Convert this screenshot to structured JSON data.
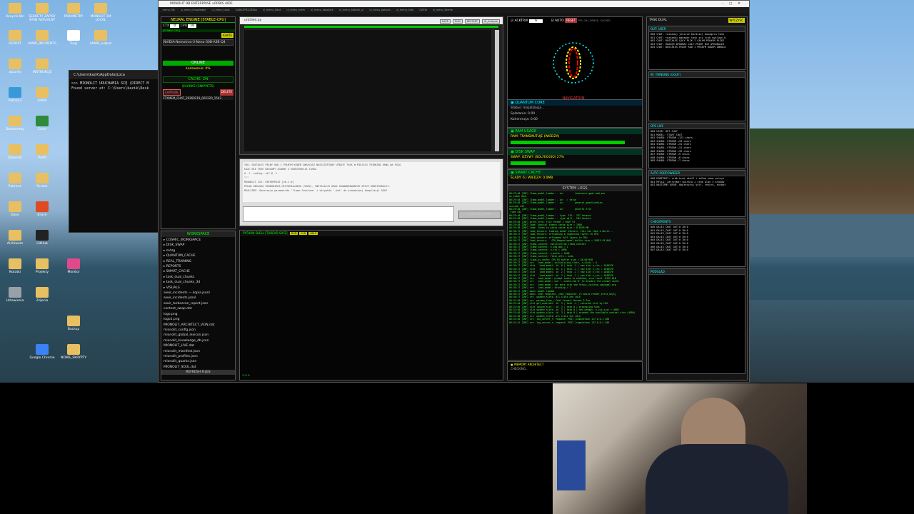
{
  "desktop": {
    "icons": [
      {
        "label": "Recycle Bin",
        "color": "#e8c062"
      },
      {
        "label": "SEKRETY ZAPISY STAN AKTUALNY",
        "color": "#e8c062"
      },
      {
        "label": "PARAMETRY",
        "color": "#e8c062"
      },
      {
        "label": "MONOLIT 1M LOCAL",
        "color": "#e8c062"
      },
      {
        "label": "REPORT",
        "color": "#e8c062"
      },
      {
        "label": "AIWIR_INCIDENTS",
        "color": "#e8c062"
      },
      {
        "label": "Tlogi",
        "color": "#ffffff"
      },
      {
        "label": "AIWIR_output",
        "color": "#e8c062"
      },
      {
        "label": "aipurity",
        "color": "#e8c062"
      },
      {
        "label": "INSTRUKCJE",
        "color": "#e8c062"
      },
      {
        "label": "Python3",
        "color": "#3a9ad9"
      },
      {
        "label": "AIWIR",
        "color": "#e8c062"
      },
      {
        "label": "Dokumenty",
        "color": "#e8c062"
      },
      {
        "label": "Excel",
        "color": "#2e8b3a"
      },
      {
        "label": "Dziennik",
        "color": "#e8c062"
      },
      {
        "label": "Profil",
        "color": "#e8c062"
      },
      {
        "label": "Pobrane",
        "color": "#e8c062"
      },
      {
        "label": "Serwer",
        "color": "#e8c062"
      },
      {
        "label": "Dane",
        "color": "#e8c062"
      },
      {
        "label": "Brave",
        "color": "#e04a22"
      },
      {
        "label": "Archiwum",
        "color": "#e8c062"
      },
      {
        "label": "GitHub",
        "color": "#222222"
      },
      {
        "label": "Notatki",
        "color": "#e8c062"
      },
      {
        "label": "Projekty",
        "color": "#e8c062"
      },
      {
        "label": "Monitor",
        "color": "#e04a8a"
      },
      {
        "label": "Ustawienia",
        "color": "#9aa0a8"
      },
      {
        "label": "Zdjecia",
        "color": "#e8c062"
      },
      {
        "label": "Google Chrome",
        "color": "#3b82f6"
      },
      {
        "label": "Backup",
        "color": "#e8c062"
      },
      {
        "label": "NOWE_SKRYPTY",
        "color": "#e8c062"
      }
    ]
  },
  "cmd": {
    "title": "C:\\Users\\kazik\\AppData\\Loca",
    "lines": ">>> MIONOLIT URUCHAMIA SIĘ (DIRECT M\nFound server at: C:\\Users\\kazik\\Desk"
  },
  "app": {
    "title": "MONOLIT 9B ENTERPRISE vORBIS AIDE",
    "menu": [
      "_menu_file",
      "ui_menu_knowledge",
      "ui_menu_tools",
      "ZABEZPIECZENIA",
      "ui_menu_kitna",
      "ui_menu_mem",
      "ui_menu_obsolute",
      "ui_menu_adenial_ui",
      "ui_menu_options",
      "ui_menu_help",
      "OZEW",
      "ui_menu_theme"
    ],
    "engine": {
      "header": "NEURAL ENGINE [STABLE-CPU]",
      "ctx_label": "CTX",
      "ctx_value": "0",
      "cpu_label": "CPU",
      "cpu_value": "16",
      "stable": "[STABLE CPU]",
      "ignite": "IGNITE",
      "model": "NVIDIA-Nemotron-3-Nano-30B-A3B-Q4",
      "online": "ONLINE",
      "loading": "Ładowanie: 0%",
      "cache": "CACHE: ON",
      "quarks": "QUARKS (SNIPPETS)",
      "capture": "CAPTURE",
      "delete": "DELETE",
      "snippet": "CTXMEM_CHAT_20260219_002220_1543"
    },
    "workspace": {
      "header": "WORKSPACE",
      "items": [
        "COSMIC_WORKSPACE",
        "DISK_SWAP",
        "mózg",
        "QUANTUM_CACHE",
        "REAL_TRAINING",
        "REPORTS",
        "SMART_CACHE",
        "task_dual_chunks",
        "task_dual_chunks_3d",
        "VISUALS",
        "aiwir_incidents — kopia.jsonl",
        "aiwir_incidents.jsonl",
        "aiwir_turboscan_report.json",
        "context_swap.dat",
        "logo.png",
        "logo1.png",
        "MIONOLIT_ARCHITECT_VEIN.dat",
        "mionolit_config.json",
        "mionolit_global_lexicon.json",
        "mionolit_knowledge_db.json",
        "MIONOLIT_LIVE.dat",
        "mionolit_manifest.json",
        "mionolit_profiles.json",
        "mionolit_quarks.json",
        "MIONOLIT_SOUL.dat"
      ],
      "refresh": "REFRESH FILES"
    },
    "editor": {
      "tab": "untitled.py",
      "btns": [
        "SAVE",
        "RUN",
        "RESTART",
        "AI_Analyze"
      ]
    },
    "chat": {
      "text": "YOU: DOSTAŁEŚ PEŁNY KOD I PEŁNYM KODEM ZWRACASZ NASZCZEPIONY UPDATE TASK W MIEJSCU THINKING OKNA NA POJA\nKIAC NIE TRZE BEZŁOMY ZGODNY Z KONSTRUKCJA TASKA\n# -*- coding: utf-8 -*-\n\"\"\"\nMIONOLIT ISI: ENTERPRISE [v0.1.0]\nPEŁNA OBSŁUGA ŚRODOWISKA HISTORIALNEGO (VENV), INSTALACJI ORAZ ZAAWANSOWANYCH OPCJI KONFIGURACJI.\nREALIZMY: Generacja parametrów 'llama-finetune' i skryptów '.bat' do prawdziwej kompilacji GGUF.",
      "send": "SEND",
      "dalej": "DALEJ"
    },
    "shell": {
      "header": "PYTHON SHELL [THREAD SAFE]",
      "prompt": ">>>",
      "btns": [
        "RUN",
        "CLR",
        "HELP"
      ]
    },
    "radar": {
      "actrix": "ACKTRIX",
      "auto": "AUTO",
      "reset": "RESET",
      "stats": "FPS: 28 | DENSE: CACHED",
      "caption": "NAVIGATION"
    },
    "quantum": {
      "header": "QUANTUM CORE",
      "status": "Status: Inicjalizacja...",
      "splatanie": "Splatanie: 0.00",
      "koherencja": "Koherencja: 0.00"
    },
    "ram": {
      "header": "RAM USAGE",
      "text": "RAM: TRANSMUTUJE (WIEDZA)",
      "fill": 0.88
    },
    "disk": {
      "header": "DISK SWAP",
      "text": "SWAP: OŻYWY (SOLFEGGIO) 27%",
      "fill": 0.27
    },
    "smart": {
      "header": "SMART CACHE",
      "text": "ŚLADY: 6 | WIEDZA: 0.0MB"
    },
    "syslog": {
      "header": "SYSTEM LOGS",
      "text": "00:29:48 [INF] llama_model_loader: - kv:        tokenizer.ggml.add_eos\nos_token bool\n00:29:48 [INF] llama_model_loader: - kv:  = false\n00:29:48 [INF] llama_model_loader: - kv:        general.quantization\nversion u32\n00:29:48 [INF] llama_model_loader: - kv:        general.file\n_type u32\n00:29:48 [INF] llama_model_loader: - type  f32:  337 tensors\n00:29:48 [INF] llama_model_loader: - type q4_K:  284 tensors\n00:29:48 [INF] print_info: file format = GGUF V3\n00:29:48 [INF] load: special tokens cache size = 1000\n00:29:48 [INF] load: token to piece cache size = 0.8459 MB\n00:30:17 [INF] load_tensors: loading model tensors, this can take a while...\n00:30:17 [INF] load_tensors: offloading 0 repeating layers to GPU\n00:30:17 [INF] load_tensors: offloaded 0/53 layers to GPU\n00:30:17 [INF] load_tensors:   CPU_Mapped model buffer size = 16813.49 MiB\n00:30:17 [INF] llama_context: constructing llama_context\n00:30:17 [INF] llama_context: n_seq_max = 1\n00:30:17 [INF] llama_context: n_ctx = 4096\n00:30:17 [INF] llama_context: n_batch = 2048\n00:30:17 [INF] llama_context: flash_attn = auto\n00:30:17 [INF] llama_kv_cache: CPU KV buffer size = 48.00 MiB\n00:30:17 [INF] srv   load_model: initializing slots, n_slots = 4\n00:30:17 [INF] slot   load_model: id  0 | task -1 | new slot n_ctx = 1048576\n00:30:17 [INF] slot   load_model: id  1 | task -1 | new slot n_ctx = 1048576\n00:30:17 [INF] slot   load_model: id  2 | task -1 | new slot n_ctx = 1048576\n00:30:17 [INF] slot   load_model: id  3 | task -1 | new slot n_ctx = 1048576\n00:30:17 [INF] srv   load_model: prompt cache is enabled, size limit: 8192 MiB\n00:30:17 [INF] srv   load_model: use '--cache-ram 0' to disable the prompt cache\n00:30:17 [INF] srv   load_model: for more info see https://github.com/ggml-org\n00:30:17 [INF] srv   load_model: thinking = 1\n00:30:17 [INF] main: model loaded\n00:30:17 [INF] main: chat template, chat_template: {% macro render_extra_keys}\n00:30:17 [INF] srv  update_slots: all slots are idle\n00:31:40 [INF] srv  params_from_: Chat format: Hermes 2 Pro\n00:31:40 [INF] slot get_availabl: id  3 | task -1 | selected slot by LRU\n00:31:40 [INF] slot launch_slot_: id  3 | task 0 | processing task\n00:31:40 [INF] slot update_slots: id  3 | task 0 | new prompt, n_ctx_slot = 4096\n00:31:40 [INF] slot update_slots: id  3 | task 0 | exceeds the available context size (4096)\n00:31:40 [INF] srv  update_slots: all slots are idle\n00:31:40 [INF] srv  log_server_r: request: POST /completion 127.0.0.1 400\n00:31:41 [INF] srv  log_server_r: request: POST /completion 127.0.0.1 200",
      "memory_header": "MEMORY ARCHITECT",
      "memory_text": "CHECKING..."
    },
    "right": {
      "title": "TASK DUAL",
      "wyczysc": "WYCZYŚĆ",
      "out_header": "OUT: USER",
      "out_lines": "000 CHAT: rozkaduj jeszcze bardziej managera task\n001 CHAT: rozkaduj manager task szy tryb myslowy K\n002 CHAT: DOSTAŁEŚ CAŁY PLIK I CAŁYM PEŁNYM PLIKI\n003 CHAT: ROASĘS WYKONAĆ CAŁY PRINT NIE WYKONALES\n004 CHAT: DOSTAŁEŚ PEŁNY KOD I PEŁNYM KODEM ZWRACA",
      "thinking_header": "IN: THINKING (GGUF)",
      "ops_header": "OPS LIVE",
      "ops_lines": "000 USER: OUT CHAT\n001 MODEL: START CHAT\n002 SHARD: STREAM +123 chars\n003 SHARD: STREAM +33 chars\n004 SHARD: STREAM +31 chars\n005 SHARD: STREAM +31 chars\n006 SHARD: STREAM +39 chars\n007 SHARD: STREAM +9 chars\n008 SHARD: STREAM +8 chars\n009 SHARD: STREAM +7 chars",
      "auto_header": "AUTO PODPOWIEDZI",
      "auto_lines": "000 KONTEKST: zrób krok skaJI i zdlow nowe prinyi\n001 MYSLA: zatrzymaj spirala i zrób plan 3 kroków\n002 NASTĘPNY KROK: doprecyzuj self, return, except",
      "check_header": "CHECKPOINTS",
      "check_lines": "000 DALEJ_CHAT OUT:0 IN:0\n001 DALEJ_CHAT OUT:0 IN:0\n002 DALEJ_CHAT OUT:0 IN:0\n003 DALEJ_CHAT OUT:0 IN:0\n004 DALEJ_CHAT OUT:0 IN:0\n005 DALEJ_CHAT OUT:0 IN:0\n006 DALEJ_CHAT OUT:0 IN:0\n007 DALEJ_CHAT OUT:0 IN:0",
      "podglad_header": "PODGLĄD"
    }
  }
}
